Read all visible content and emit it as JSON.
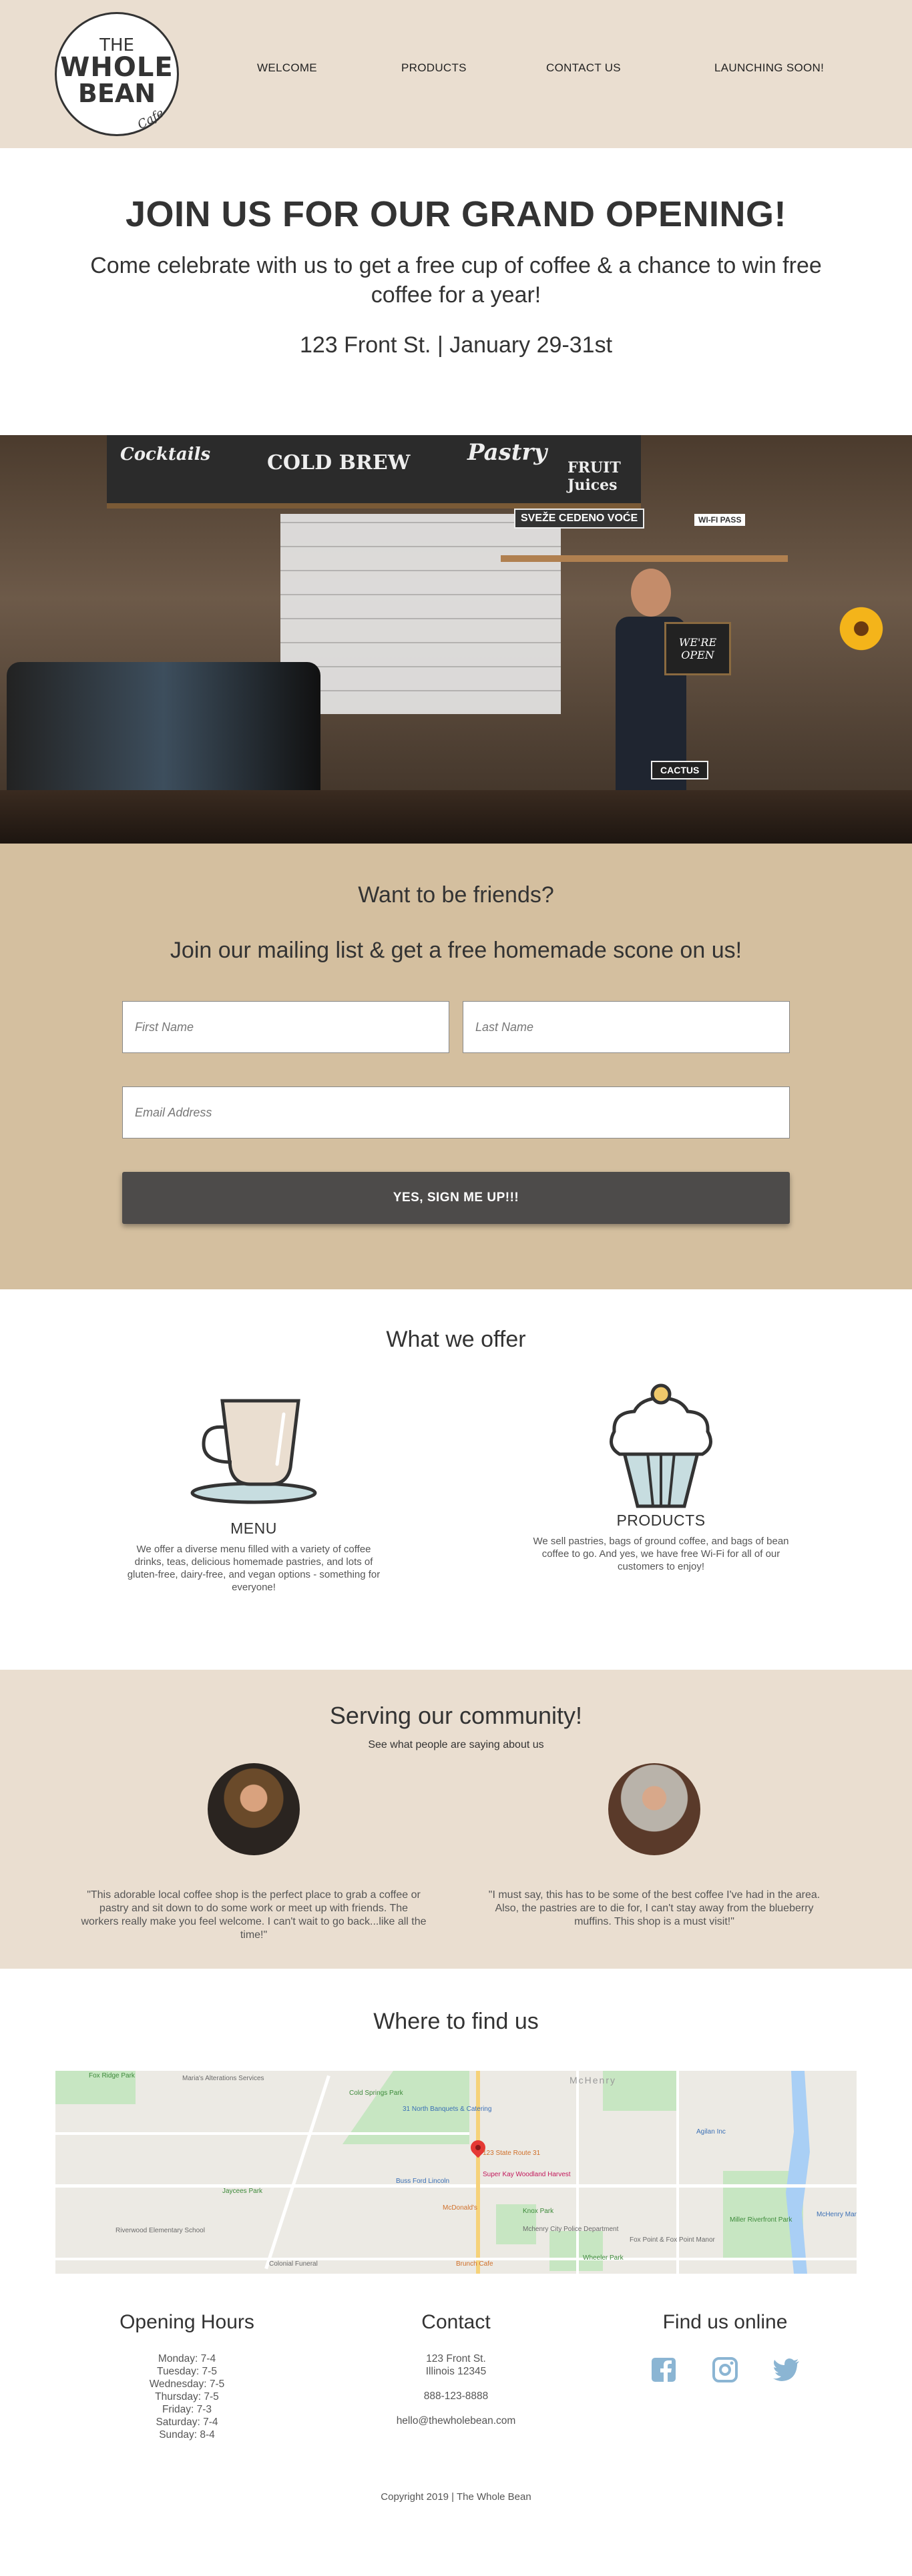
{
  "header": {
    "logo": {
      "line1": "THE",
      "line2": "WHOLE",
      "line3": "BEAN",
      "script": "Cafe"
    },
    "nav": [
      "WELCOME",
      "PRODUCTS",
      "CONTACT US",
      "LAUNCHING SOON!"
    ]
  },
  "hero": {
    "title": "JOIN US FOR OUR GRAND OPENING!",
    "subtitle": "Come celebrate with us to get a free cup of coffee & a chance to win free coffee for a year!",
    "address": "123 Front St. | January 29-31st"
  },
  "photo": {
    "board_words": [
      "Cocktails",
      "COLD BREW",
      "Pastry",
      "FRUIT Juices",
      "SVEŽE CEDENO VOĆE",
      "WI-FI PASS"
    ],
    "chalk_sign": "WE'RE OPEN",
    "cactus_label": "CACTUS"
  },
  "signup": {
    "heading": "Want to be friends?",
    "subheading": "Join our mailing list & get a free homemade scone on us!",
    "first_name_placeholder": "First Name",
    "last_name_placeholder": "Last Name",
    "email_placeholder": "Email Address",
    "button_label": "YES, SIGN ME UP!!!"
  },
  "offer": {
    "heading": "What we offer",
    "items": [
      {
        "icon": "coffee-cup-icon",
        "title": "MENU",
        "text": "We offer a diverse menu filled with a variety of coffee drinks, teas, delicious homemade pastries, and lots of gluten-free, dairy-free, and vegan options - something for everyone!"
      },
      {
        "icon": "cupcake-icon",
        "title": "PRODUCTS",
        "text": "We sell pastries, bags of ground coffee, and bags of bean coffee to go. And yes, we have free Wi-Fi for all of our customers to enjoy!"
      }
    ]
  },
  "community": {
    "heading": "Serving our community!",
    "tagline": "See what people are saying about us",
    "testimonials": [
      {
        "quote": "\"This adorable local coffee shop is the perfect place to grab a coffee or pastry and sit down to do some work or meet up with friends. The workers really make you feel welcome. I can't wait to go back...like all the time!\""
      },
      {
        "quote": "\"I must say, this has to be some of the best coffee I've had in the area. Also, the pastries are to die for, I can't stay away from the blueberry muffins. This shop is a must visit!\""
      }
    ]
  },
  "find": {
    "heading": "Where to find us",
    "map_labels": {
      "pin": "123 State Route 31",
      "fox_ridge": "Fox Ridge Park",
      "alterations": "Maria's Alterations Services",
      "cold_springs": "Cold Springs Park",
      "banquets": "31 North Banquets & Catering",
      "mchenry": "McHenry",
      "agilan": "Agilan Inc",
      "jaycees": "Jaycees Park",
      "buss_ford": "Buss Ford Lincoln",
      "super_kay": "Super Kay Woodland Harvest",
      "mcdonalds": "McDonald's",
      "knox": "Knox Park",
      "police": "Mchenry City Police Department",
      "fox_point": "Fox Point & Fox Point Manor",
      "miller": "Miller Riverfront Park",
      "riverwood": "Riverwood Elementary School",
      "colonial": "Colonial Funeral",
      "brunch": "Brunch Cafe",
      "wheeler": "Wheeler Park",
      "mchenry_marina": "McHenry Marina"
    }
  },
  "footer": {
    "hours": {
      "heading": "Opening Hours",
      "lines": [
        "Monday: 7-4",
        "Tuesday: 7-5",
        "Wednesday: 7-5",
        "Thursday: 7-5",
        "Friday: 7-3",
        "Saturday: 7-4",
        "Sunday: 8-4"
      ]
    },
    "contact": {
      "heading": "Contact",
      "address1": "123 Front St.",
      "address2": "Illinois 12345",
      "phone": "888-123-8888",
      "email": "hello@thewholebean.com"
    },
    "online": {
      "heading": "Find us online",
      "icons": [
        "facebook-icon",
        "instagram-icon",
        "twitter-icon"
      ]
    },
    "copyright": "Copyright 2019 | The Whole Bean"
  },
  "colors": {
    "header_bg": "#eaded0",
    "signup_bg": "#d4bf9f",
    "button_bg": "#4d4b4a",
    "social": "#8bb5d3"
  }
}
